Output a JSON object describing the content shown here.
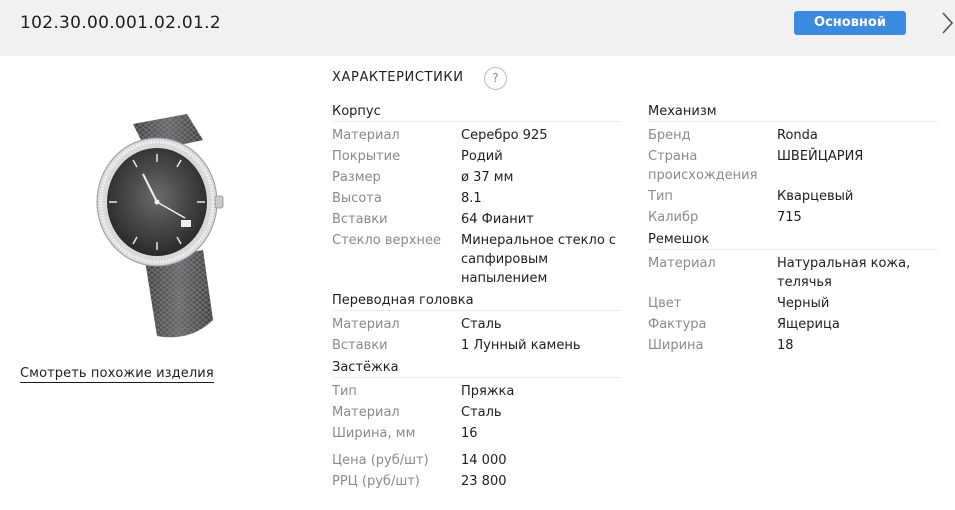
{
  "header": {
    "sku": "102.30.00.001.02.01.2",
    "badge": "Основной",
    "next_icon": "chevron-right-icon"
  },
  "left": {
    "similar_link": "Смотреть похожие изделия"
  },
  "specs": {
    "title": "ХАРАКТЕРИСТИКИ",
    "help": "?",
    "korpus": {
      "title": "Корпус",
      "rows": [
        {
          "label": "Материал",
          "value": "Серебро 925"
        },
        {
          "label": "Покрытие",
          "value": "Родий"
        },
        {
          "label": "Размер",
          "value": "ø 37 мм"
        },
        {
          "label": "Высота",
          "value": "8.1"
        },
        {
          "label": "Вставки",
          "value": "64 Фианит"
        },
        {
          "label": "Стекло верхнее",
          "value": "Минеральное стекло с сапфировым напылением"
        }
      ]
    },
    "golovka": {
      "title": "Переводная головка",
      "rows": [
        {
          "label": "Материал",
          "value": "Сталь"
        },
        {
          "label": "Вставки",
          "value": "1 Лунный камень"
        }
      ]
    },
    "zastezhka": {
      "title": "Застёжка",
      "rows": [
        {
          "label": "Тип",
          "value": "Пряжка"
        },
        {
          "label": "Материал",
          "value": "Сталь"
        },
        {
          "label": "Ширина, мм",
          "value": "16"
        }
      ]
    },
    "prices": [
      {
        "label": "Цена (руб/шт)",
        "value": "14 000"
      },
      {
        "label": "РРЦ (руб/шт)",
        "value": "23 800"
      }
    ],
    "mekhanizm": {
      "title": "Механизм",
      "rows": [
        {
          "label": "Бренд",
          "value": "Ronda"
        },
        {
          "label": "Страна происхождения",
          "value": "ШВЕЙЦАРИЯ"
        },
        {
          "label": "Тип",
          "value": "Кварцевый"
        },
        {
          "label": "Калибр",
          "value": "715"
        }
      ]
    },
    "remeshok": {
      "title": "Ремешок",
      "rows": [
        {
          "label": "Материал",
          "value": "Натуральная кожа, телячья"
        },
        {
          "label": "Цвет",
          "value": "Черный"
        },
        {
          "label": "Фактура",
          "value": "Ящерица"
        },
        {
          "label": "Ширина",
          "value": "18"
        }
      ]
    }
  },
  "colors": {
    "accent": "#3b8be0",
    "topbar_bg": "#f1f1f1",
    "label_gray": "#8a8a8a"
  }
}
